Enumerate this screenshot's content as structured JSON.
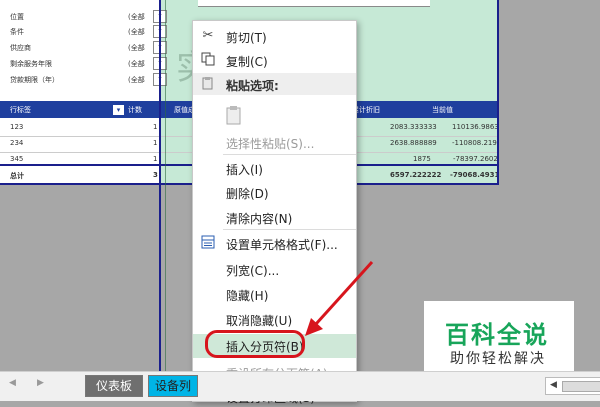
{
  "filters": [
    {
      "label": "位置",
      "value": "(全部"
    },
    {
      "label": "条件",
      "value": "(全部"
    },
    {
      "label": "供应商",
      "value": "(全部"
    },
    {
      "label": "剩余服务年限",
      "value": "(全部"
    },
    {
      "label": "贷款期限（年）",
      "value": "(全部"
    }
  ],
  "table": {
    "headers": [
      "行标签",
      "计数",
      "原值成本",
      "累计折旧",
      "当前值"
    ],
    "rows": [
      {
        "label": "123",
        "count": "1",
        "depr": "2083.333333",
        "current": "110136.9863"
      },
      {
        "label": "234",
        "count": "1",
        "depr": "2638.888889",
        "current": "-110808.2192"
      },
      {
        "label": "345",
        "count": "1",
        "depr": "1875",
        "current": "-78397.26027"
      }
    ],
    "total": {
      "label": "总计",
      "count": "3",
      "depr": "6597.222222",
      "current": "-79068.49315"
    }
  },
  "background_char": "实",
  "context_menu": {
    "cut": "剪切(T)",
    "copy": "复制(C)",
    "paste_options": "粘贴选项:",
    "paste_special": "选择性粘贴(S)...",
    "insert": "插入(I)",
    "delete": "删除(D)",
    "clear": "清除内容(N)",
    "format_cells": "设置单元格格式(F)...",
    "column_width": "列宽(C)...",
    "hide": "隐藏(H)",
    "unhide": "取消隐藏(U)",
    "insert_page_break": "插入分页符(B)",
    "reset_page_breaks": "重设所有分页符(A)",
    "set_print_area": "设置打印区域(S)"
  },
  "sheet_tabs": [
    "仪表板",
    "设备列"
  ],
  "watermark": {
    "title": "百科全说",
    "subtitle": "助你轻松解决"
  },
  "colors": {
    "highlight": "#d7151d",
    "table_header": "#1f3f9e",
    "active_tab": "#00b4e6",
    "watermark_green": "#18a55a"
  },
  "icons": [
    "scissors-icon",
    "copy-icon",
    "paste-icon",
    "format-cells-icon",
    "arrow-left-icon",
    "arrow-right-icon"
  ]
}
